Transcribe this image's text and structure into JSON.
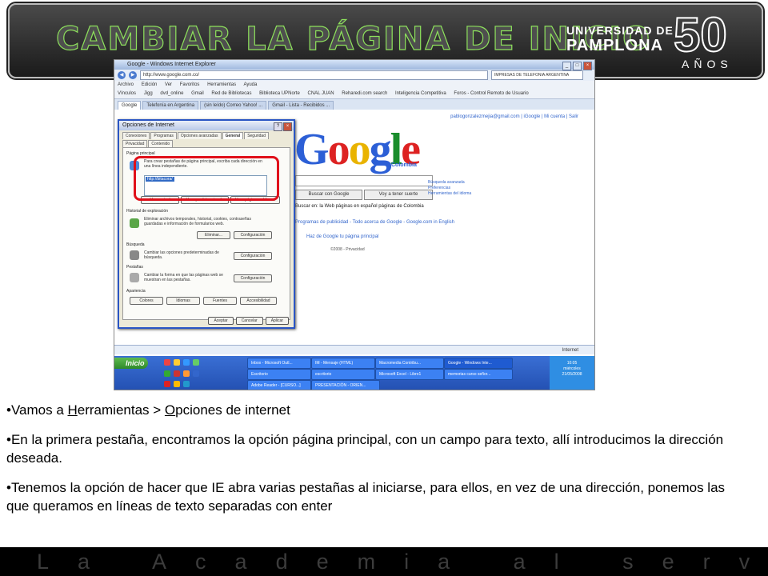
{
  "slide": {
    "title": "CAMBIAR LA PÁGINA DE INICIO",
    "logo": {
      "univ": "UNIVERSIDAD DE",
      "name": "PAMPLONA",
      "years": "50",
      "anos": "AÑOS"
    },
    "footer": "La Academia al servicio de la Vida",
    "bullets": {
      "b1_pre": "•Vamos a ",
      "b1_h": "H",
      "b1_mid": "erramientas > ",
      "b1_o": "O",
      "b1_post": "pciones de internet",
      "b2": "•En la primera pestaña, encontramos la opción página principal, con un campo para texto, allí introducimos la dirección deseada.",
      "b3": "•Tenemos la opción de hacer que IE abra varias pestañas al iniciarse, para ellos, en vez de una dirección, ponemos las que queramos en líneas de texto separadas con enter"
    }
  },
  "screenshot": {
    "window_title": "Google - Windows Internet Explorer",
    "url": "http://www.google.com.co/",
    "search_box": "IMPRESAS DE TELEFONIA ARGENTINA",
    "menu": [
      "Archivo",
      "Edición",
      "Ver",
      "Favoritos",
      "Herramientas",
      "Ayuda"
    ],
    "links": [
      "Vínculos",
      "Jigg",
      "dvd_online",
      "Gmail",
      "Red de Bibliotecas",
      "Biblioteca UPNorte",
      "CNAL JUAN",
      "Reharedi.com search",
      "Inteligencia Competitiva",
      "Foros - Control Remoto de Usuario"
    ],
    "tabs": [
      "Google",
      "Telefonía en Argentina",
      "(sin leído) Correo Yahoo! ...",
      "Gmail - Lista - Recibidos ..."
    ],
    "user_bar": "pablogonzalezmejia@gmail.com | iGoogle | Mi cuenta | Salir",
    "google": {
      "logo": "Google",
      "country": "Colombia",
      "btn_search": "Buscar con Google",
      "btn_lucky": "Voy a tener suerte",
      "adv": [
        "Búsqueda avanzada",
        "Preferencias",
        "Herramientas del idioma"
      ],
      "radio": "Buscar en:  la Web  páginas en español  páginas de Colombia",
      "links1": "Programas de publicidad - Todo acerca de Google - Google.com in English",
      "links2": "Haz de Google tu página principal",
      "copyright": "©2008 - Privacidad"
    },
    "dialog": {
      "title": "Opciones de Internet",
      "tabs": [
        "Conexiones",
        "Programas",
        "Opciones avanzadas",
        "General",
        "Seguridad",
        "Privacidad",
        "Contenido"
      ],
      "homepage_label": "Página principal",
      "homepage_text": "Para crear pestañas de página principal, escriba cada dirección en una línea independiente.",
      "homepage_value": "http://bitacora/",
      "btn_use_current": "Usar actual",
      "btn_use_default": "Usar predeterminada",
      "btn_use_blank": "Usar página en blanco",
      "history_label": "Historial de exploración",
      "history_text": "Eliminar archivos temporales, historial, cookies, contraseñas guardadas e información de formularios web.",
      "btn_delete": "Eliminar...",
      "btn_config1": "Configuración",
      "search_label": "Búsqueda",
      "search_text": "Cambiar las opciones predeterminadas de búsqueda.",
      "btn_config2": "Configuración",
      "tabs_label": "Pestañas",
      "tabs_text": "Cambiar la forma en que las páginas web se muestran en las pestañas.",
      "btn_config3": "Configuración",
      "appearance_label": "Apariencia",
      "btn_colors": "Colores",
      "btn_languages": "Idiomas",
      "btn_fonts": "Fuentes",
      "btn_access": "Accesibilidad",
      "btn_ok": "Aceptar",
      "btn_cancel": "Cancelar",
      "btn_apply": "Aplicar"
    },
    "status": "Internet",
    "taskbar": {
      "start": "Inicio",
      "tasks_row1": [
        "Inbox - Microsoft Outl...",
        "IM - Mensaje (HTML)",
        "Macromedia Contribu...",
        "Google - Windows Inte..."
      ],
      "tasks_row2": [
        "Escritorio",
        "escritorio",
        "Microsoft Excel - Libro1",
        "memorias curso señor..."
      ],
      "task_row3": "Adobe Reader - [CURSO...]",
      "task_row3b": "PRESENTACIÓN - ORIEN...",
      "clock": [
        "10:05",
        "miércoles",
        "21/05/2008"
      ]
    }
  }
}
